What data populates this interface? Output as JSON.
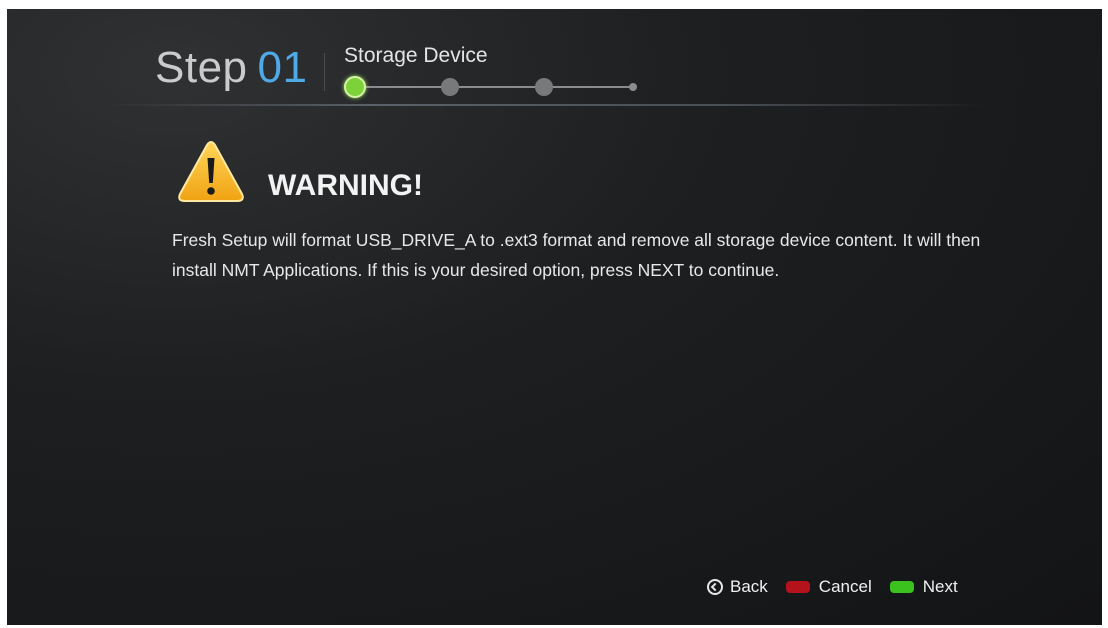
{
  "header": {
    "step_word": "Step",
    "step_number": "01",
    "step_name": "Storage Device",
    "progress": {
      "current_step": 1,
      "total_steps": 3
    }
  },
  "warning": {
    "icon": "warning-triangle-icon",
    "title": "WARNING!",
    "message": "Fresh Setup will format USB_DRIVE_A to .ext3 format and remove all storage device content. It will then install NMT Applications. If this is your desired option, press NEXT to continue."
  },
  "footer": {
    "back_label": "Back",
    "cancel_label": "Cancel",
    "next_label": "Next"
  },
  "colors": {
    "step_number": "#4fa9e6",
    "active_step": "#7dd23a",
    "cancel_key": "#b5121b",
    "next_key": "#3cc21f",
    "warning_icon": "#f5b21e"
  }
}
